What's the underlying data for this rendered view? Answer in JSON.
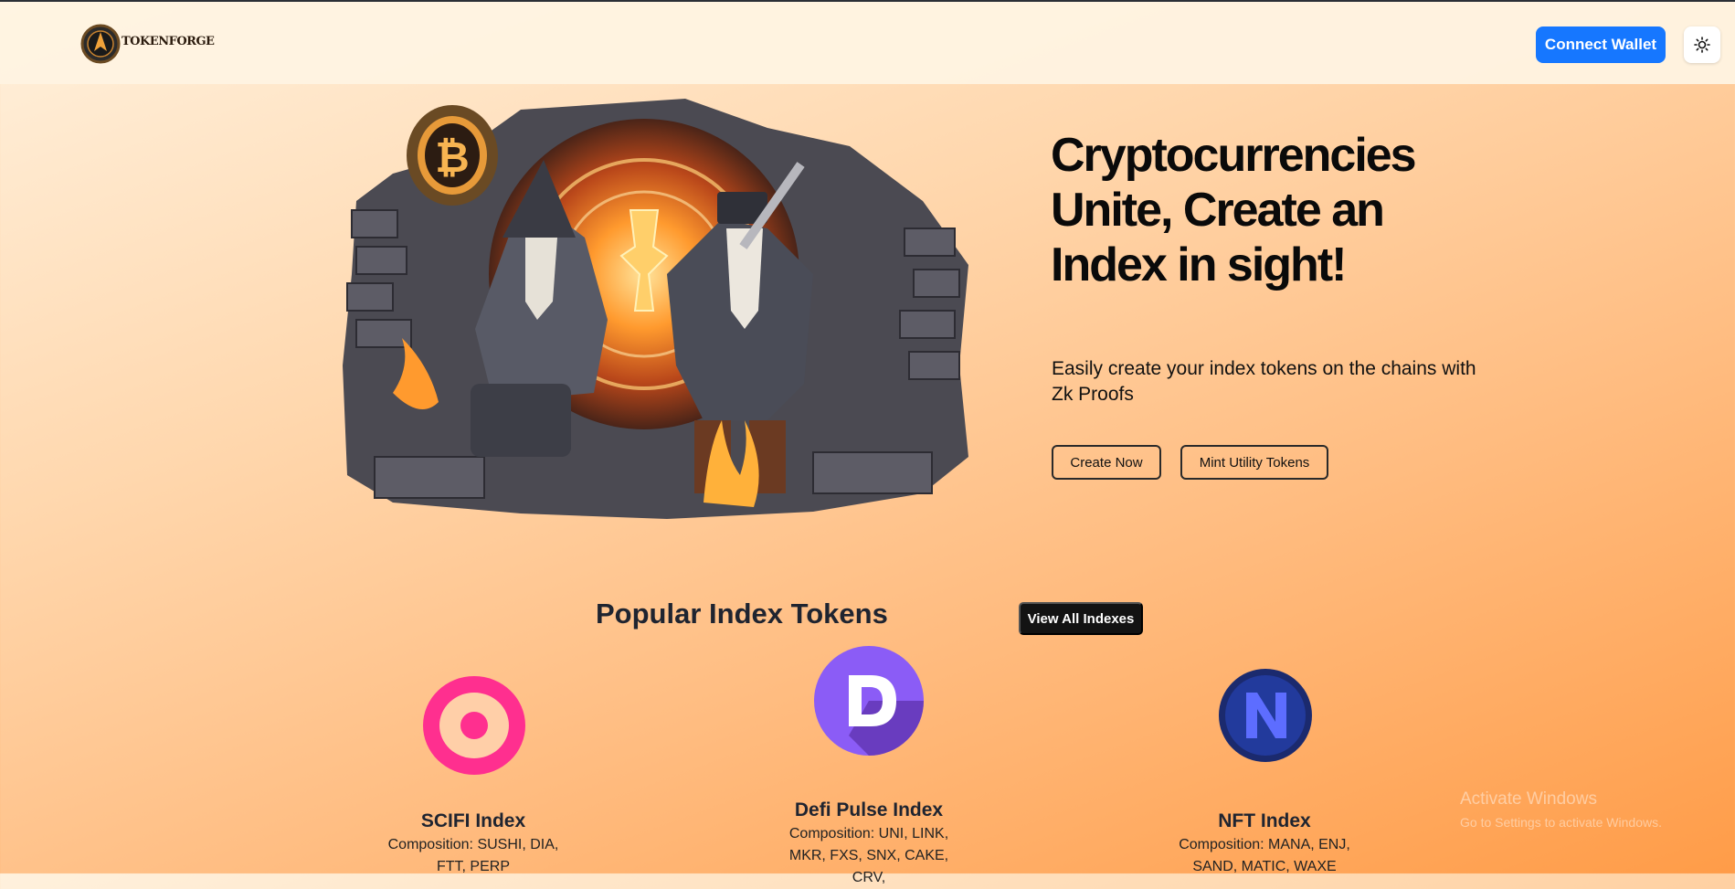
{
  "header": {
    "logo_text": "TOKENFORGE",
    "connect_label": "Connect Wallet",
    "theme_icon": "sun-icon"
  },
  "hero": {
    "title": "Cryptocurrencies Unite, Create an Index in sight!",
    "subtitle": "Easily create your index tokens on the chains with Zk Proofs",
    "create_label": "Create Now",
    "mint_label": "Mint Utility Tokens",
    "art_icons": [
      "bitcoin-coin-icon",
      "blacksmith-illustration"
    ]
  },
  "popular": {
    "title": "Popular Index Tokens",
    "view_all_label": "View All Indexes",
    "cards": [
      {
        "name": "SCIFI Index",
        "composition": "Composition: SUSHI, DIA, FTT, PERP",
        "icon": "scifi-index-icon",
        "color": "#ff2f8f"
      },
      {
        "name": "Defi Pulse Index",
        "composition": "Composition: UNI, LINK, MKR, FXS, SNX, CAKE, CRV,",
        "icon": "defi-pulse-icon",
        "color": "#7b4fd6"
      },
      {
        "name": "NFT Index",
        "composition": "Composition: MANA, ENJ, SAND, MATIC, WAXE",
        "icon": "nft-index-icon",
        "color": "#22358c"
      }
    ]
  },
  "watermark": {
    "line1": "Activate Windows",
    "line2": "Go to Settings to activate Windows."
  },
  "colors": {
    "accent": "#1677ff",
    "dark_button": "#131313"
  }
}
